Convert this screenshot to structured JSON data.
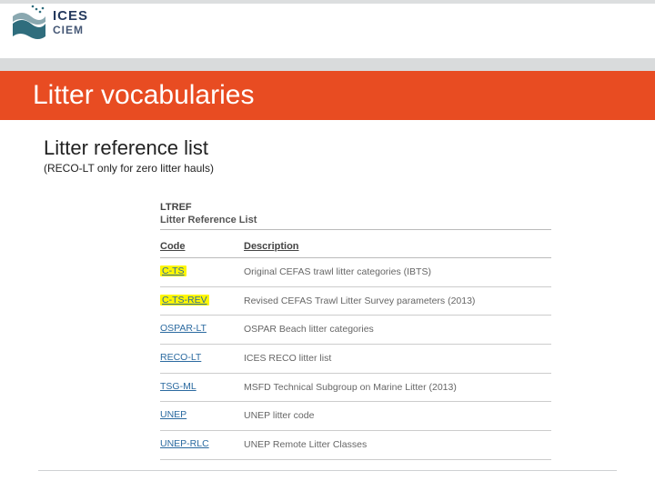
{
  "logo": {
    "line1": "ICES",
    "line2": "CIEM"
  },
  "title": "Litter vocabularies",
  "subhead": "Litter reference list",
  "note": "(RECO-LT only for zero litter hauls)",
  "table": {
    "header_code": "LTREF",
    "header_subtitle": "Litter Reference List",
    "col_code": "Code",
    "col_desc": "Description",
    "rows": [
      {
        "code": "C-TS",
        "desc": "Original CEFAS trawl litter categories (IBTS)",
        "highlight": true
      },
      {
        "code": "C-TS-REV",
        "desc": "Revised CEFAS Trawl Litter Survey parameters (2013)",
        "highlight": true
      },
      {
        "code": "OSPAR-LT",
        "desc": "OSPAR Beach litter categories",
        "highlight": false
      },
      {
        "code": "RECO-LT",
        "desc": "ICES RECO litter list",
        "highlight": false
      },
      {
        "code": "TSG-ML",
        "desc": "MSFD Technical Subgroup on Marine Litter (2013)",
        "highlight": false
      },
      {
        "code": "UNEP",
        "desc": "UNEP litter code",
        "highlight": false
      },
      {
        "code": "UNEP-RLC",
        "desc": "UNEP Remote Litter Classes",
        "highlight": false
      }
    ]
  }
}
